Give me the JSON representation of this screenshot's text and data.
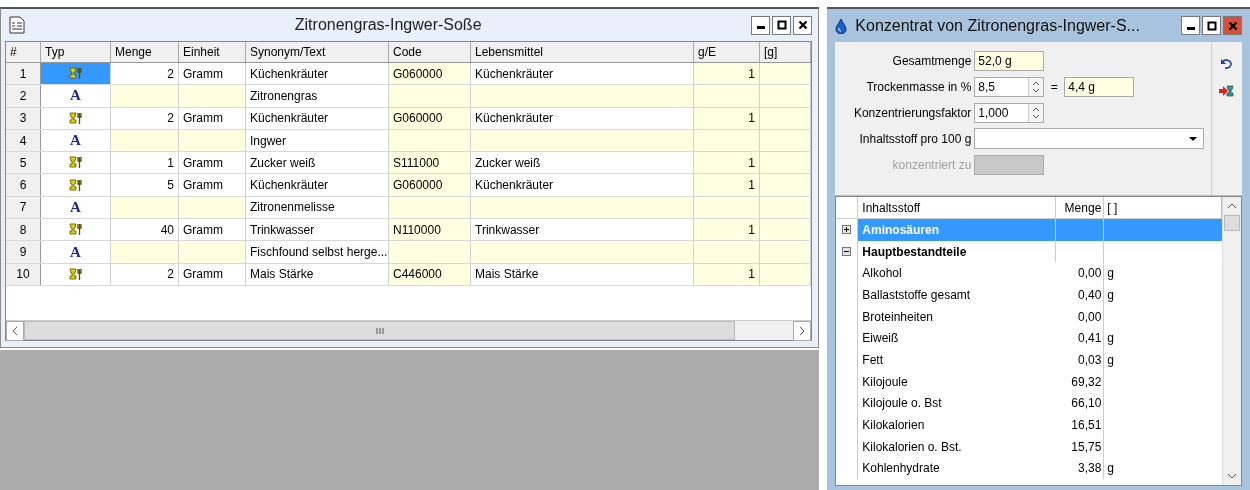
{
  "recipe_window": {
    "title": "Zitronengras-Ingwer-Soße",
    "columns": [
      "#",
      "Typ",
      "Menge",
      "Einheit",
      "Synonym/Text",
      "Code",
      "Lebensmittel",
      "g/E",
      "[g]"
    ],
    "rows": [
      {
        "num": "1",
        "kind": "food",
        "selected": true,
        "menge": "2",
        "einheit": "Gramm",
        "text": "Küchenkräuter",
        "code": "G060000",
        "lebensmittel": "Küchenkräuter",
        "ge": "1"
      },
      {
        "num": "2",
        "kind": "text",
        "selected": false,
        "glyph": "A",
        "text": "Zitronengras"
      },
      {
        "num": "3",
        "kind": "food",
        "selected": false,
        "menge": "2",
        "einheit": "Gramm",
        "text": "Küchenkräuter",
        "code": "G060000",
        "lebensmittel": "Küchenkräuter",
        "ge": "1"
      },
      {
        "num": "4",
        "kind": "text",
        "selected": false,
        "glyph": "A",
        "text": "Ingwer"
      },
      {
        "num": "5",
        "kind": "food",
        "selected": false,
        "menge": "1",
        "einheit": "Gramm",
        "text": "Zucker weiß",
        "code": "S111000",
        "lebensmittel": "Zucker weiß",
        "ge": "1"
      },
      {
        "num": "6",
        "kind": "food",
        "selected": false,
        "menge": "5",
        "einheit": "Gramm",
        "text": "Küchenkräuter",
        "code": "G060000",
        "lebensmittel": "Küchenkräuter",
        "ge": "1"
      },
      {
        "num": "7",
        "kind": "text",
        "selected": false,
        "glyph": "A",
        "text": "Zitronenmelisse"
      },
      {
        "num": "8",
        "kind": "food",
        "selected": false,
        "menge": "40",
        "einheit": "Gramm",
        "text": "Trinkwasser",
        "code": "N110000",
        "lebensmittel": "Trinkwasser",
        "ge": "1"
      },
      {
        "num": "9",
        "kind": "text",
        "selected": false,
        "glyph": "A",
        "text": "Fischfound selbst herge..."
      },
      {
        "num": "10",
        "kind": "food",
        "selected": false,
        "menge": "2",
        "einheit": "Gramm",
        "text": "Mais Stärke",
        "code": "C446000",
        "lebensmittel": "Mais Stärke",
        "ge": "1"
      }
    ]
  },
  "concentrate_window": {
    "title": "Konzentrat von Zitronengras-Ingwer-S...",
    "gesamtmenge": {
      "label": "Gesamtmenge",
      "value": "52,0 g"
    },
    "trockenmasse": {
      "label": "Trockenmasse in %",
      "value": "8,5",
      "equals": "=",
      "result": "4,4 g"
    },
    "faktor": {
      "label": "Konzentrierungsfaktor",
      "value": "1,000"
    },
    "inhaltsstoff": {
      "label": "Inhaltsstoff pro 100 g"
    },
    "konzentriert": {
      "label": "konzentriert zu",
      "disabled": true
    },
    "list_columns": [
      "Inhaltsstoff",
      "Menge",
      "[ ]"
    ],
    "tree": [
      {
        "name": "Aminosäuren",
        "expanded": false,
        "selected": true
      },
      {
        "name": "Hauptbestandteile",
        "expanded": true,
        "selected": false,
        "children": [
          {
            "name": "Alkohol",
            "menge": "0,00",
            "unit": "g"
          },
          {
            "name": "Ballaststoffe gesamt",
            "menge": "0,40",
            "unit": "g"
          },
          {
            "name": "Broteinheiten",
            "menge": "0,00"
          },
          {
            "name": "Eiweiß",
            "menge": "0,41",
            "unit": "g"
          },
          {
            "name": "Fett",
            "menge": "0,03",
            "unit": "g"
          },
          {
            "name": "Kilojoule",
            "menge": "69,32"
          },
          {
            "name": "Kilojoule o. Bst",
            "menge": "66,10"
          },
          {
            "name": "Kilokalorien",
            "menge": "16,51"
          },
          {
            "name": "Kilokalorien o. Bst.",
            "menge": "15,75"
          },
          {
            "name": "Kohlenhydrate",
            "menge": "3,38",
            "unit": "g"
          }
        ]
      }
    ]
  }
}
